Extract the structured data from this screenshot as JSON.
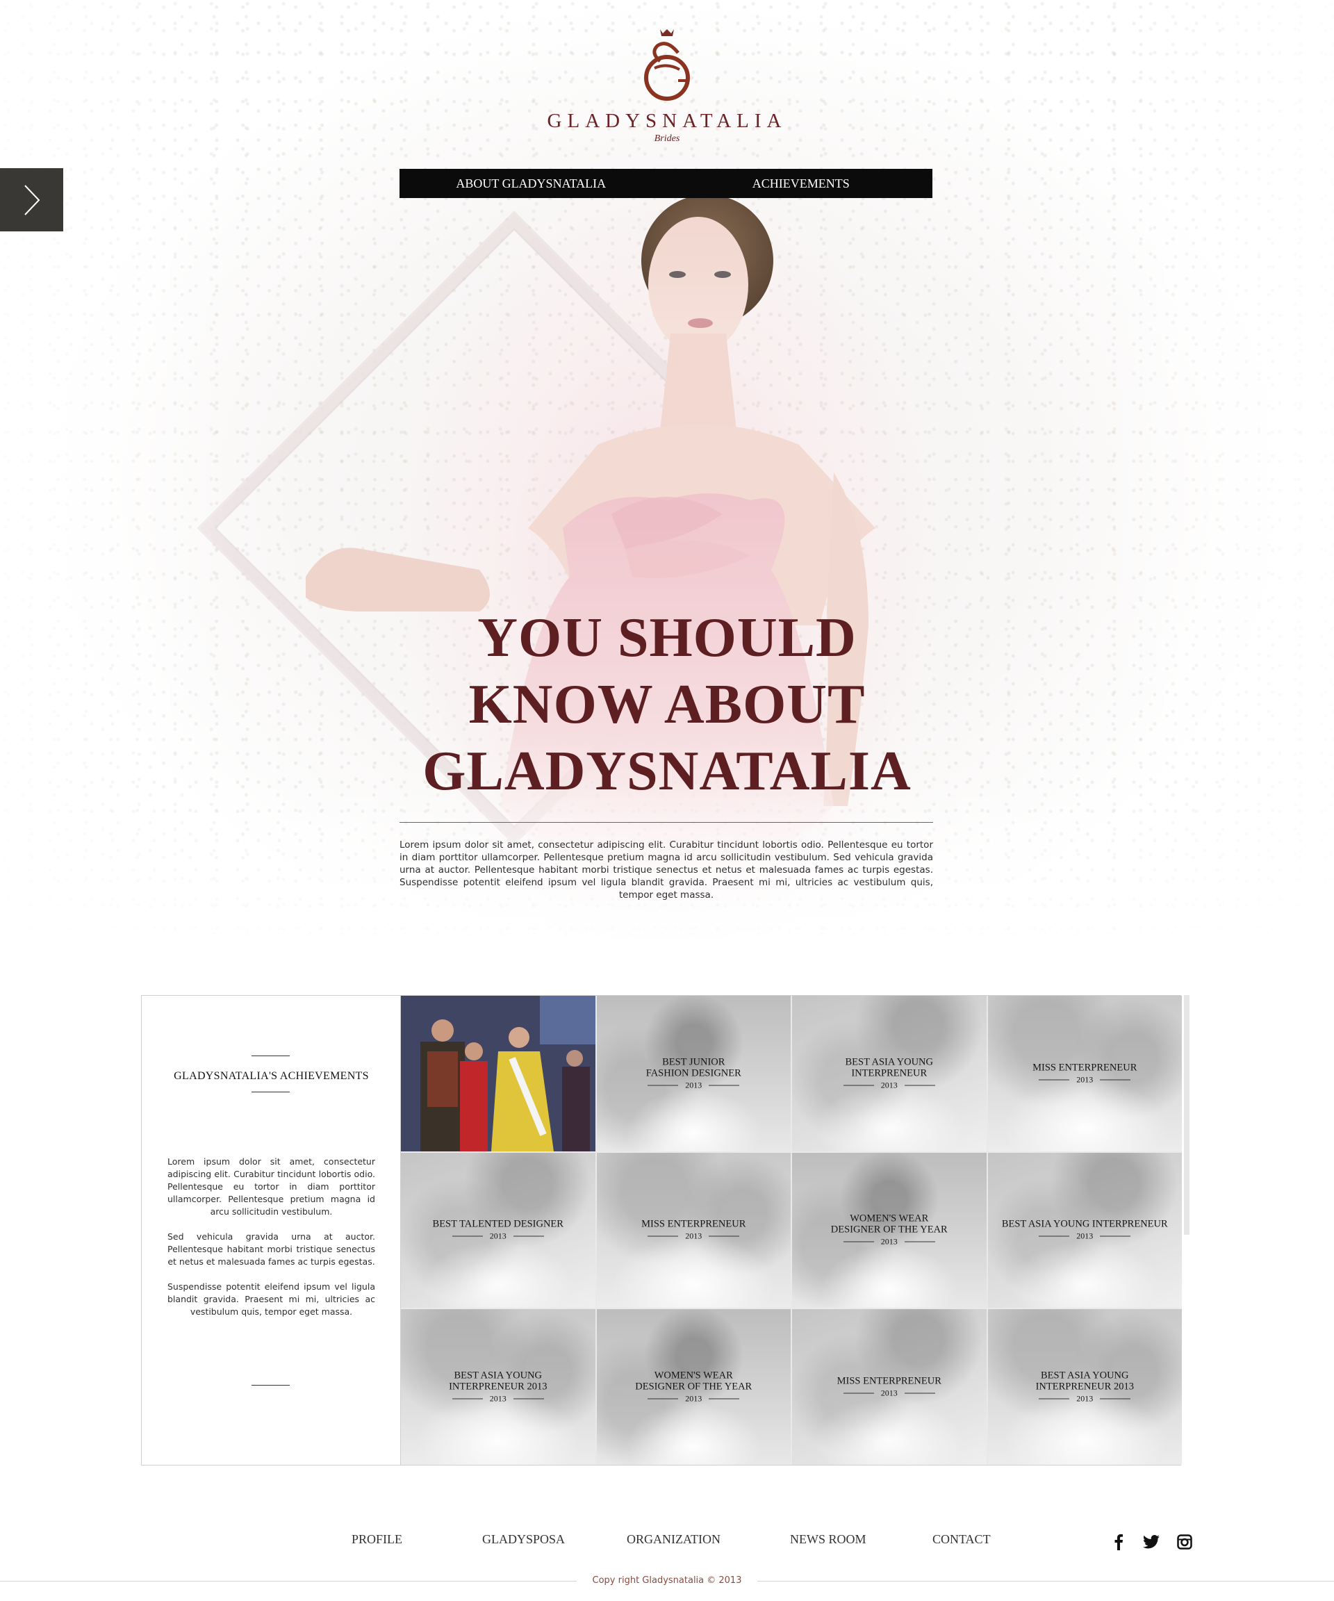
{
  "brand": {
    "name": "GLADYSNATALIA",
    "tagline": "Brides",
    "accent_color": "#6b2325",
    "logo_icon": "monogram-g-icon"
  },
  "top_nav": {
    "items": [
      {
        "label": "ABOUT GLADYSNATALIA"
      },
      {
        "label": "ACHIEVEMENTS"
      }
    ]
  },
  "side_toggle": {
    "icon": "chevron-right-icon"
  },
  "hero": {
    "heading_lines": [
      "YOU SHOULD",
      "KNOW ABOUT",
      "GLADYSNATALIA"
    ],
    "paragraph": "Lorem ipsum dolor sit amet, consectetur adipiscing elit. Curabitur tincidunt lobortis odio. Pellentesque eu tortor in diam porttitor ullamcorper. Pellentesque pretium magna id arcu sollicitudin vestibulum. Sed vehicula gravida urna at auctor. Pellentesque habitant morbi tristique senectus et netus et malesuada fames ac turpis egestas. Suspendisse potentit eleifend ipsum vel ligula blandit gravida. Praesent mi mi, ultricies ac vestibulum quis, tempor eget massa."
  },
  "achievements": {
    "title": "GLADYSNATALIA'S ACHIEVEMENTS",
    "paragraphs": [
      "Lorem ipsum dolor sit amet, consectetur adipiscing elit. Curabitur tincidunt lobortis odio. Pellentesque eu tortor in diam porttitor ullamcorper. Pellentesque pretium magna id arcu sollicitudin vestibulum.",
      "Sed vehicula gravida urna at auctor. Pellentesque habitant morbi tristique senectus et netus et malesuada fames ac turpis egestas.",
      "Suspendisse potentit eleifend ipsum vel ligula blandit gravida. Praesent mi mi, ultricies ac vestibulum quis, tempor eget massa."
    ],
    "tiles": [
      {
        "title": "",
        "year": "",
        "highlighted": true
      },
      {
        "title": "BEST JUNIOR\nFASHION DESIGNER",
        "year": "2013"
      },
      {
        "title": "BEST ASIA YOUNG\nINTERPRENEUR",
        "year": "2013"
      },
      {
        "title": "MISS ENTERPRENEUR",
        "year": "2013"
      },
      {
        "title": "BEST TALENTED DESIGNER",
        "year": "2013"
      },
      {
        "title": "MISS ENTERPRENEUR",
        "year": "2013"
      },
      {
        "title": "WOMEN'S WEAR\nDESIGNER OF THE YEAR",
        "year": "2013"
      },
      {
        "title": "BEST ASIA YOUNG INTERPRENEUR",
        "year": "2013"
      },
      {
        "title": "BEST ASIA YOUNG\nINTERPRENEUR 2013",
        "year": "2013"
      },
      {
        "title": "WOMEN'S WEAR\nDESIGNER OF THE YEAR",
        "year": "2013"
      },
      {
        "title": "MISS ENTERPRENEUR",
        "year": "2013"
      },
      {
        "title": "BEST ASIA YOUNG\nINTERPRENEUR 2013",
        "year": "2013"
      }
    ]
  },
  "footer": {
    "nav": [
      "PROFILE",
      "GLADYSPOSA",
      "ORGANIZATION",
      "NEWS ROOM",
      "CONTACT"
    ],
    "social_icons": [
      "facebook-icon",
      "twitter-icon",
      "instagram-icon"
    ],
    "copyright": "Copy right Gladysnatalia © 2013"
  }
}
